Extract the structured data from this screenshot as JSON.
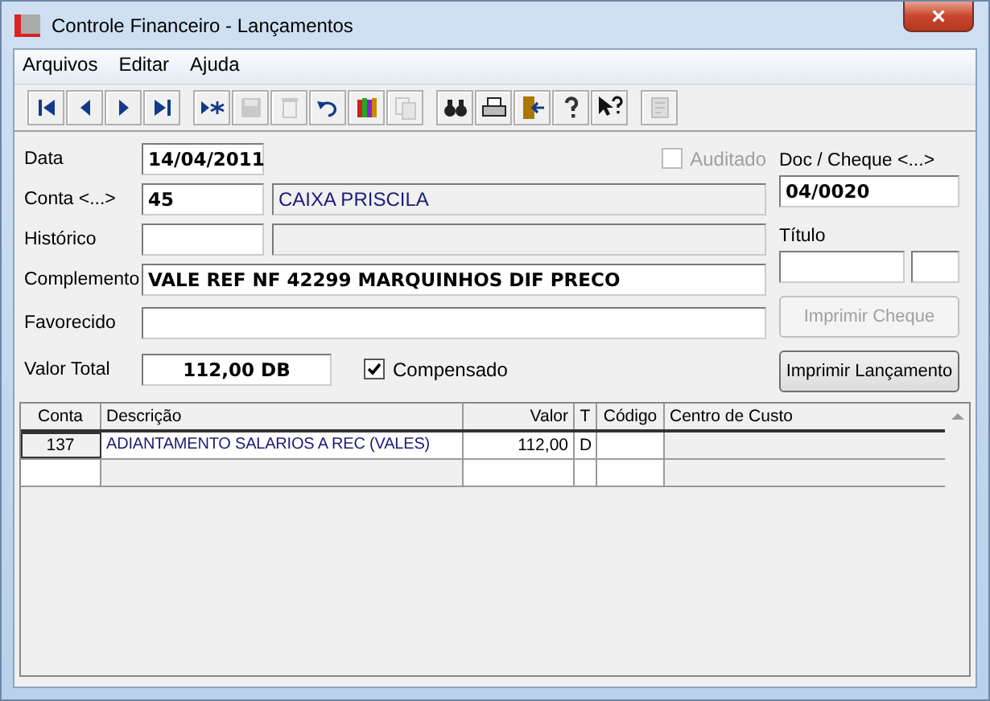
{
  "window": {
    "title": "Controle Financeiro - Lançamentos",
    "close": "×"
  },
  "menu": [
    "Arquivos",
    "Editar",
    "Ajuda"
  ],
  "toolbar": [
    [
      {
        "kind": "first",
        "disabled": false
      },
      {
        "kind": "prev",
        "disabled": false
      },
      {
        "kind": "next",
        "disabled": false
      },
      {
        "kind": "last",
        "disabled": false
      }
    ],
    [
      {
        "kind": "new",
        "disabled": false
      },
      {
        "kind": "save",
        "disabled": true
      },
      {
        "kind": "delete",
        "disabled": true
      },
      {
        "kind": "undo",
        "disabled": false
      },
      {
        "kind": "books",
        "disabled": false
      },
      {
        "kind": "copy",
        "disabled": true
      }
    ],
    [
      {
        "kind": "find",
        "disabled": false
      },
      {
        "kind": "print",
        "disabled": false
      },
      {
        "kind": "exit",
        "disabled": false
      },
      {
        "kind": "help",
        "disabled": false
      },
      {
        "kind": "whatsthis",
        "disabled": false
      }
    ],
    [
      {
        "kind": "report",
        "disabled": true
      }
    ]
  ],
  "form": {
    "data": {
      "label": "Data",
      "value": "14/04/2011"
    },
    "auditado": {
      "label": "Auditado",
      "checked": false,
      "disabled": true
    },
    "conta": {
      "label": "Conta <...>",
      "value": "45",
      "name": "CAIXA PRISCILA"
    },
    "historico": {
      "label": "Histórico"
    },
    "complemento": {
      "label": "Complemento",
      "value": "VALE REF NF 42299 MARQUINHOS DIF PRECO"
    },
    "favorecido": {
      "label": "Favorecido"
    },
    "valor_total": {
      "label": "Valor Total",
      "value": "112,00 DB"
    },
    "compensado": {
      "label": "Compensado",
      "checked": true,
      "disabled": false
    },
    "doc_cheque": {
      "label": "Doc / Cheque <...>",
      "value": "04/0020"
    },
    "titulo": {
      "label": "Título"
    },
    "buttons": [
      {
        "label": "Imprimir Cheque",
        "disabled": true
      },
      {
        "label": "Imprimir Lançamento",
        "disabled": false
      }
    ]
  },
  "table": {
    "columns": [
      {
        "label": "Conta"
      },
      {
        "label": "Descrição"
      },
      {
        "label": "Valor"
      },
      {
        "label": "T"
      },
      {
        "label": "Código"
      },
      {
        "label": "Centro de Custo"
      }
    ],
    "rows": [
      {
        "cells": [
          "137",
          "ADIANTAMENTO SALARIOS A REC (VALES)",
          "112,00",
          "D"
        ]
      }
    ]
  }
}
